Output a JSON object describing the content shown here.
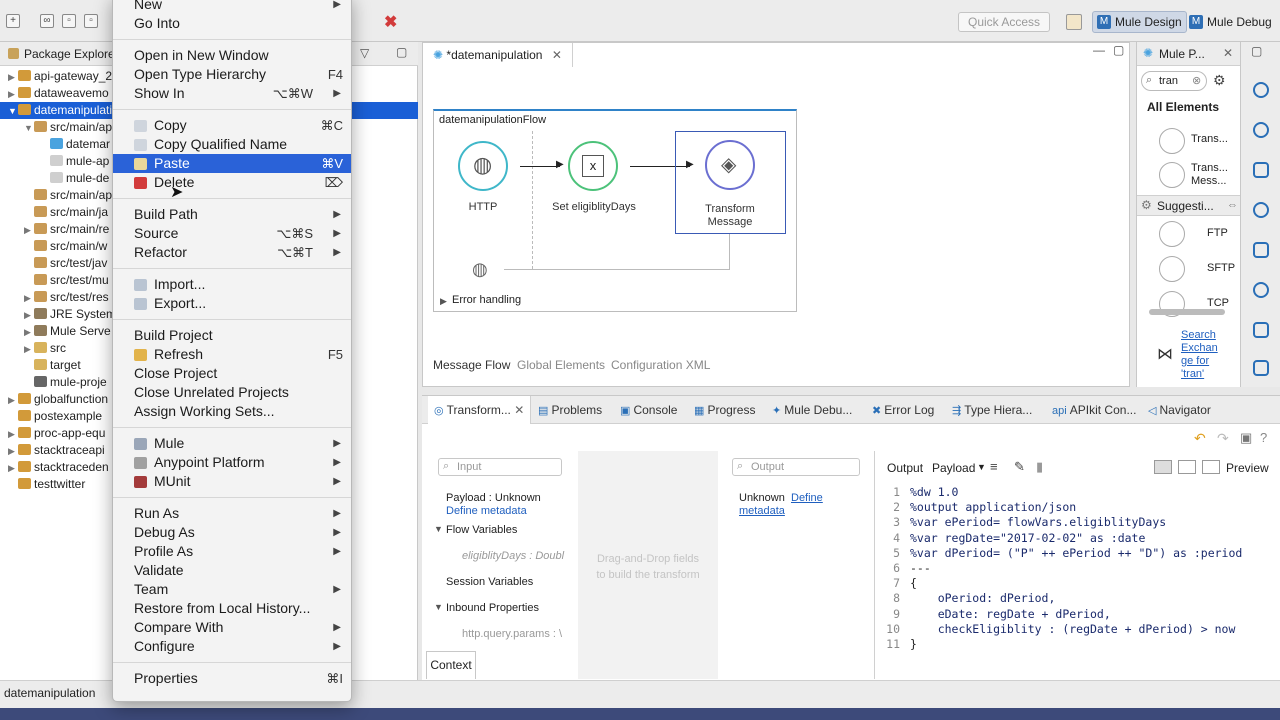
{
  "toolbar": {
    "quick_access_placeholder": "Quick Access",
    "perspectives": [
      "Mule Design",
      "Mule Debug"
    ]
  },
  "package_explorer": {
    "title": "Package Explorer",
    "rows": [
      {
        "label": "api-gateway_2",
        "level": 0,
        "twisty": "▶",
        "color": "#d29a3a"
      },
      {
        "label": "dataweavemo",
        "level": 0,
        "twisty": "▶",
        "color": "#d29a3a"
      },
      {
        "label": "datemanipulati",
        "level": 0,
        "twisty": "▼",
        "color": "#d29a3a",
        "selected": true
      },
      {
        "label": "src/main/ap",
        "level": 1,
        "twisty": "▼",
        "color": "#c89a56"
      },
      {
        "label": "datemar",
        "level": 2,
        "twisty": "",
        "color": "#4aa3df"
      },
      {
        "label": "mule-ap",
        "level": 2,
        "twisty": "",
        "color": "#cfcfcf"
      },
      {
        "label": "mule-de",
        "level": 2,
        "twisty": "",
        "color": "#cfcfcf"
      },
      {
        "label": "src/main/ap",
        "level": 1,
        "twisty": "",
        "color": "#c89a56"
      },
      {
        "label": "src/main/ja",
        "level": 1,
        "twisty": "",
        "color": "#c89a56"
      },
      {
        "label": "src/main/re",
        "level": 1,
        "twisty": "▶",
        "color": "#c89a56"
      },
      {
        "label": "src/main/w",
        "level": 1,
        "twisty": "",
        "color": "#c89a56"
      },
      {
        "label": "src/test/jav",
        "level": 1,
        "twisty": "",
        "color": "#c89a56"
      },
      {
        "label": "src/test/mu",
        "level": 1,
        "twisty": "",
        "color": "#c89a56"
      },
      {
        "label": "src/test/res",
        "level": 1,
        "twisty": "▶",
        "color": "#c89a56"
      },
      {
        "label": "JRE System",
        "level": 1,
        "twisty": "▶",
        "color": "#8f7b5b"
      },
      {
        "label": "Mule Serve",
        "level": 1,
        "twisty": "▶",
        "color": "#8f7b5b"
      },
      {
        "label": "src",
        "level": 1,
        "twisty": "▶",
        "color": "#d8b35c"
      },
      {
        "label": "target",
        "level": 1,
        "twisty": "",
        "color": "#d8b35c"
      },
      {
        "label": "mule-proje",
        "level": 1,
        "twisty": "",
        "color": "#666666"
      },
      {
        "label": "globalfunction",
        "level": 0,
        "twisty": "▶",
        "color": "#d29a3a"
      },
      {
        "label": "postexample",
        "level": 0,
        "twisty": "",
        "color": "#d29a3a"
      },
      {
        "label": "proc-app-equ",
        "level": 0,
        "twisty": "▶",
        "color": "#d29a3a"
      },
      {
        "label": "stacktraceapi",
        "level": 0,
        "twisty": "▶",
        "color": "#d29a3a"
      },
      {
        "label": "stacktraceden",
        "level": 0,
        "twisty": "▶",
        "color": "#d29a3a"
      },
      {
        "label": "testtwitter",
        "level": 0,
        "twisty": "",
        "color": "#d29a3a"
      }
    ]
  },
  "context_menu": {
    "items": [
      {
        "label": "New",
        "arrow": true
      },
      {
        "label": "Go Into"
      },
      {
        "sep": true
      },
      {
        "label": "Open in New Window"
      },
      {
        "label": "Open Type Hierarchy",
        "shortcut": "F4"
      },
      {
        "label": "Show In",
        "shortcut": "⌥⌘W",
        "arrow": true
      },
      {
        "sep": true
      },
      {
        "label": "Copy",
        "shortcut": "⌘C",
        "icon": "#cfd5dd"
      },
      {
        "label": "Copy Qualified Name",
        "icon": "#cfd5dd"
      },
      {
        "label": "Paste",
        "shortcut": "⌘V",
        "icon": "#e9d79b",
        "highlight": true
      },
      {
        "label": "Delete",
        "shortcut": "⌦",
        "icon": "#d23b3b"
      },
      {
        "sep": true
      },
      {
        "label": "Build Path",
        "arrow": true
      },
      {
        "label": "Source",
        "shortcut": "⌥⌘S",
        "arrow": true
      },
      {
        "label": "Refactor",
        "shortcut": "⌥⌘T",
        "arrow": true
      },
      {
        "sep": true
      },
      {
        "label": "Import...",
        "icon": "#b9c4d2"
      },
      {
        "label": "Export...",
        "icon": "#b9c4d2"
      },
      {
        "sep": true
      },
      {
        "label": "Build Project"
      },
      {
        "label": "Refresh",
        "shortcut": "F5",
        "icon": "#e2b34a"
      },
      {
        "label": "Close Project"
      },
      {
        "label": "Close Unrelated Projects"
      },
      {
        "label": "Assign Working Sets..."
      },
      {
        "sep": true
      },
      {
        "label": "Mule",
        "arrow": true,
        "icon": "#9aa6b8"
      },
      {
        "label": "Anypoint Platform",
        "arrow": true,
        "icon": "#a0a0a0"
      },
      {
        "label": "MUnit",
        "arrow": true,
        "icon": "#a33a3a"
      },
      {
        "sep": true
      },
      {
        "label": "Run As",
        "arrow": true
      },
      {
        "label": "Debug As",
        "arrow": true
      },
      {
        "label": "Profile As",
        "arrow": true
      },
      {
        "label": "Validate"
      },
      {
        "label": "Team",
        "arrow": true
      },
      {
        "label": "Restore from Local History..."
      },
      {
        "label": "Compare With",
        "arrow": true
      },
      {
        "label": "Configure",
        "arrow": true
      },
      {
        "sep": true
      },
      {
        "label": "Properties",
        "shortcut": "⌘I"
      }
    ]
  },
  "editor": {
    "tab_label": "*datemanipulation",
    "flow_name": "datemanipulationFlow",
    "nodes": {
      "http": "HTTP",
      "set_var": "Set eligiblityDays",
      "transform": "Transform\nMessage"
    },
    "error_handling": "Error handling",
    "bottom_tabs": [
      "Message Flow",
      "Global Elements",
      "Configuration XML"
    ]
  },
  "palette": {
    "tab_label": "Mule P...",
    "search_value": "tran",
    "section_all": "All Elements",
    "items": [
      "Trans...",
      "Trans...\nMess..."
    ],
    "suggestions_label": "Suggesti...",
    "suggestions": [
      "FTP",
      "SFTP",
      "TCP"
    ],
    "exchange_link": "Search\nExchan\nge for\n'tran'"
  },
  "bottom_panel": {
    "tabs": [
      "Transform...",
      "Problems",
      "Console",
      "Progress",
      "Mule Debu...",
      "Error Log",
      "Type Hiera...",
      "APIkit Con...",
      "Navigator"
    ],
    "input_placeholder": "Input",
    "output_placeholder": "Output",
    "payload_unknown": "Payload : Unknown",
    "define_metadata": "Define metadata",
    "flow_variables": "Flow Variables",
    "eligibility_var": "eligiblityDays : Doubl",
    "session_variables": "Session Variables",
    "inbound_properties": "Inbound Properties",
    "http_query": "http.query.params : \\",
    "context_tab": "Context",
    "dnd_hint": "Drag-and-Drop fields\nto build the transform",
    "output_unknown": "Unknown",
    "output_define_a": "Define",
    "output_define_b": "metadata",
    "output_label": "Output",
    "payload_dropdown": "Payload",
    "preview_label": "Preview",
    "code_lines": [
      {
        "n": "1",
        "text": "%dw 1.0"
      },
      {
        "n": "2",
        "text": "%output application/json"
      },
      {
        "n": "3",
        "text": "%var ePeriod= flowVars.eligiblityDays"
      },
      {
        "n": "4",
        "text": "%var regDate=\"2017-02-02\" as :date"
      },
      {
        "n": "5",
        "text": "%var dPeriod= (\"P\" ++ ePeriod ++ \"D\") as :period"
      },
      {
        "n": "6",
        "text": "---"
      },
      {
        "n": "7",
        "text": "{"
      },
      {
        "n": "8",
        "text": "    oPeriod: dPeriod,"
      },
      {
        "n": "9",
        "text": "    eDate: regDate + dPeriod,"
      },
      {
        "n": "10",
        "text": "    checkEligiblity : (regDate + dPeriod) > now"
      },
      {
        "n": "11",
        "text": "}"
      }
    ]
  },
  "status": {
    "text": "datemanipulation"
  },
  "colors": {
    "accent": "#2a62d8",
    "selection": "#1a5fd6",
    "flow_border": "#2f82c8",
    "link": "#1f5fbf"
  }
}
